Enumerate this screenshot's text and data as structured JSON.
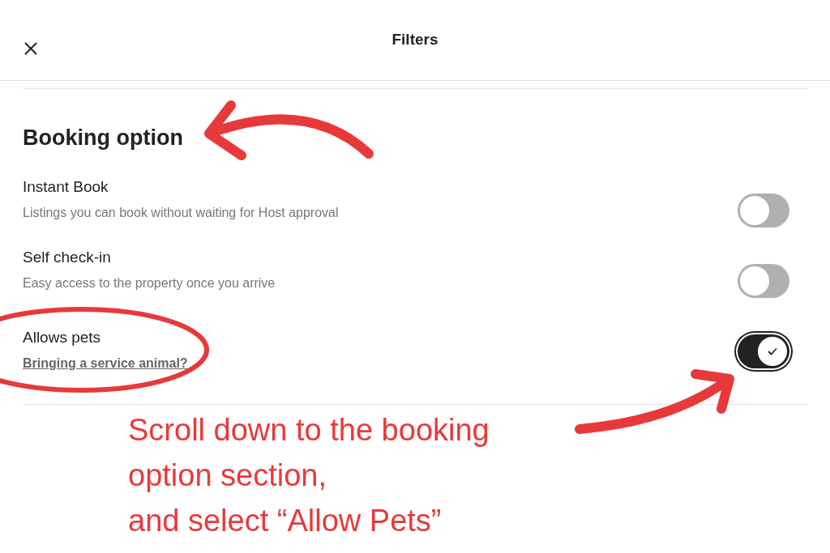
{
  "header": {
    "title": "Filters"
  },
  "section": {
    "title": "Booking option"
  },
  "options": [
    {
      "kind": "description",
      "label": "Instant Book",
      "text": "Listings you can book without waiting for Host approval",
      "on": false
    },
    {
      "kind": "description",
      "label": "Self check-in",
      "text": "Easy access to the property once you arrive",
      "on": false
    },
    {
      "kind": "link",
      "label": "Allows pets",
      "text": "Bringing a service animal?",
      "on": true
    }
  ],
  "annotation": {
    "lines": [
      "Scroll down to the booking",
      "option section,",
      "and select “Allow Pets”"
    ]
  }
}
